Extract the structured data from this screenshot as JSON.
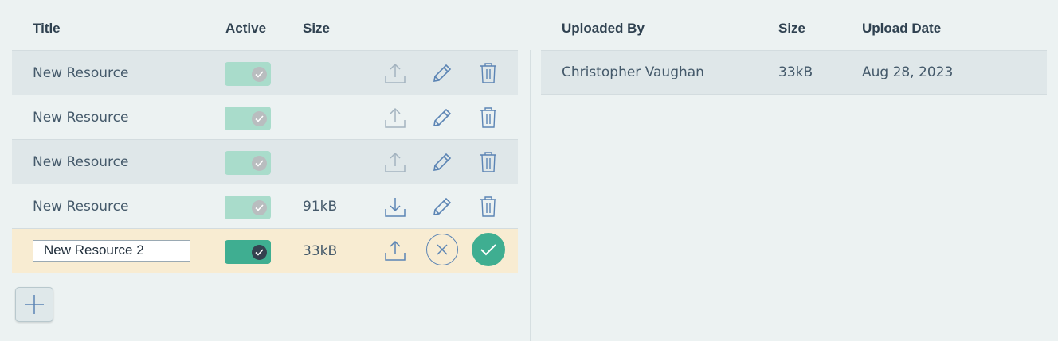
{
  "left_table": {
    "headers": {
      "title": "Title",
      "active": "Active",
      "size": "Size"
    },
    "rows": [
      {
        "title": "New Resource",
        "size": "",
        "active": true,
        "file_action": "upload-icon"
      },
      {
        "title": "New Resource",
        "size": "",
        "active": true,
        "file_action": "upload-icon"
      },
      {
        "title": "New Resource",
        "size": "",
        "active": true,
        "file_action": "upload-icon"
      },
      {
        "title": "New Resource",
        "size": "91kB",
        "active": true,
        "file_action": "download-icon"
      }
    ],
    "editing_row": {
      "title_value": "New Resource 2",
      "size": "33kB",
      "active": true
    }
  },
  "right_table": {
    "headers": {
      "uploaded_by": "Uploaded By",
      "size": "Size",
      "upload_date": "Upload Date"
    },
    "rows": [
      {
        "uploaded_by": "Christopher Vaughan",
        "size": "33kB",
        "upload_date": "Aug 28, 2023"
      }
    ]
  },
  "colors": {
    "accent_green": "#3fae91",
    "editing_row_bg": "#f8ecd2",
    "icon_blue": "#5b84b4"
  }
}
